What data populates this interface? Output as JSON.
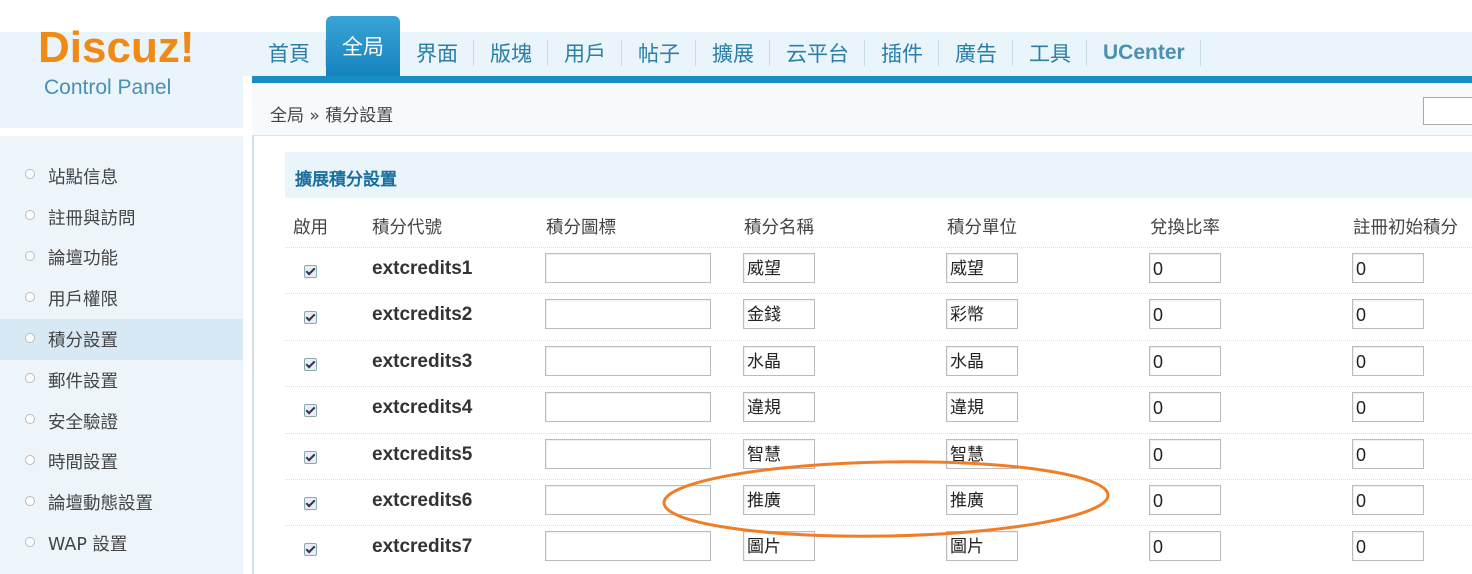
{
  "logo": {
    "title": "Discuz!",
    "subtitle": "Control Panel"
  },
  "nav": {
    "tabs": [
      {
        "label": "首頁"
      },
      {
        "label": "全局",
        "active": true
      },
      {
        "label": "界面"
      },
      {
        "label": "版塊"
      },
      {
        "label": "用戶"
      },
      {
        "label": "帖子"
      },
      {
        "label": "擴展"
      },
      {
        "label": "云平台"
      },
      {
        "label": "插件"
      },
      {
        "label": "廣告"
      },
      {
        "label": "工具"
      },
      {
        "label": "UCenter"
      }
    ]
  },
  "breadcrumb": {
    "text": "全局 » 積分設置"
  },
  "sidebar": {
    "items": [
      {
        "label": "站點信息"
      },
      {
        "label": "註冊與訪問"
      },
      {
        "label": "論壇功能"
      },
      {
        "label": "用戶權限"
      },
      {
        "label": "積分設置",
        "active": true
      },
      {
        "label": "郵件設置"
      },
      {
        "label": "安全驗證"
      },
      {
        "label": "時間設置"
      },
      {
        "label": "論壇動態設置"
      },
      {
        "label": "WAP 設置"
      }
    ]
  },
  "section": {
    "title": "擴展積分設置"
  },
  "table": {
    "headers": {
      "enabled": "啟用",
      "code": "積分代號",
      "icon": "積分圖標",
      "name": "積分名稱",
      "unit": "積分單位",
      "ratio": "兌換比率",
      "init": "註冊初始積分"
    },
    "rows": [
      {
        "enabled": true,
        "code": "extcredits1",
        "icon": "",
        "name": "威望",
        "unit": "威望",
        "ratio": "0",
        "init": "0"
      },
      {
        "enabled": true,
        "code": "extcredits2",
        "icon": "",
        "name": "金錢",
        "unit": "彩幣",
        "ratio": "0",
        "init": "0"
      },
      {
        "enabled": true,
        "code": "extcredits3",
        "icon": "",
        "name": "水晶",
        "unit": "水晶",
        "ratio": "0",
        "init": "0"
      },
      {
        "enabled": true,
        "code": "extcredits4",
        "icon": "",
        "name": "違規",
        "unit": "違規",
        "ratio": "0",
        "init": "0"
      },
      {
        "enabled": true,
        "code": "extcredits5",
        "icon": "",
        "name": "智慧",
        "unit": "智慧",
        "ratio": "0",
        "init": "0"
      },
      {
        "enabled": true,
        "code": "extcredits6",
        "icon": "",
        "name": "推廣",
        "unit": "推廣",
        "ratio": "0",
        "init": "0"
      },
      {
        "enabled": true,
        "code": "extcredits7",
        "icon": "",
        "name": "圖片",
        "unit": "圖片",
        "ratio": "0",
        "init": "0"
      }
    ]
  },
  "annotation": {
    "color": "#f07d28"
  }
}
